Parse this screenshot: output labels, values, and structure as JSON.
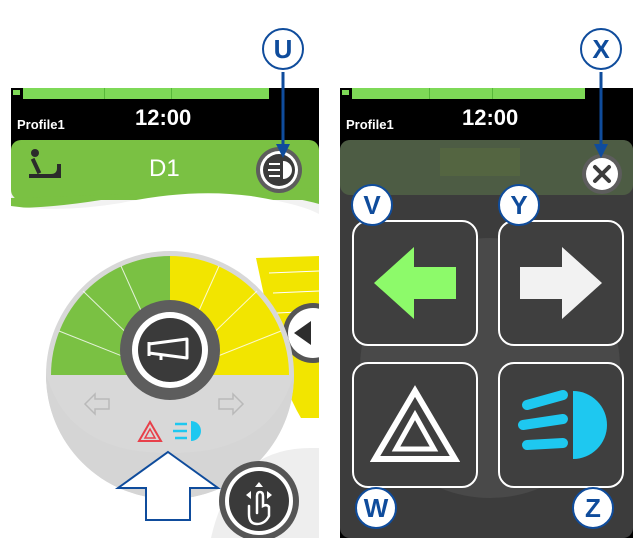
{
  "left_screen": {
    "profile": "Profile1",
    "time": "12:00",
    "mode_title": "D1",
    "battery_level": 0.83
  },
  "right_screen": {
    "profile": "Profile1",
    "time": "12:00",
    "battery_level": 0.83
  },
  "callouts": [
    "U",
    "V",
    "W",
    "X",
    "Y",
    "Z"
  ],
  "colors": {
    "green": "#7ac143",
    "yellow": "#f2e500",
    "callout_blue": "#0f4c9c",
    "light_cyan": "#1ec8f0",
    "hazard_red": "#e8404a",
    "arrow_green": "#8dfa6a"
  },
  "icons": [
    "joystick-seat-icon",
    "light-icon",
    "horn-icon",
    "arrow-left-icon",
    "arrow-right-icon",
    "hazard-icon",
    "touch-gesture-icon",
    "close-icon",
    "up-arrow-icon"
  ]
}
